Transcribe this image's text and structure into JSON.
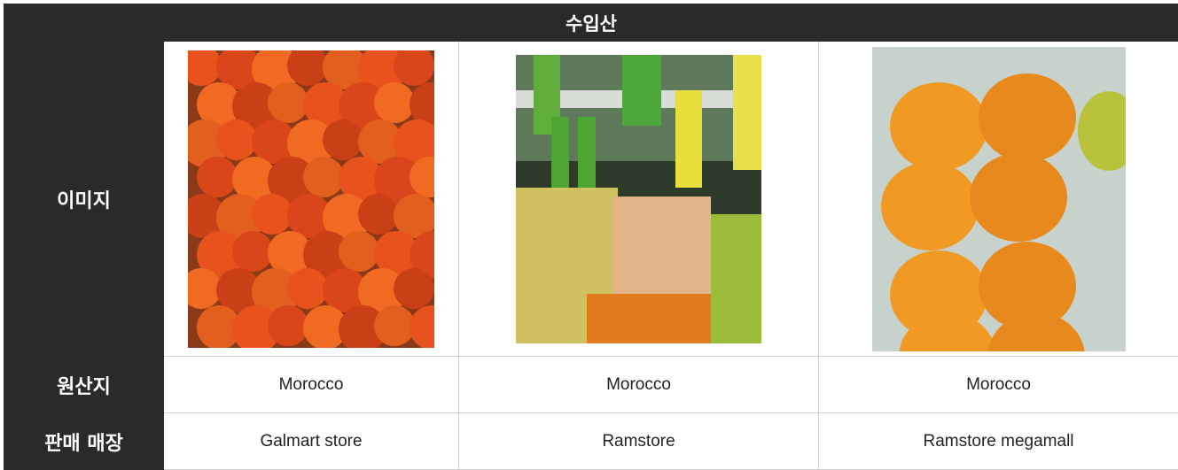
{
  "header": {
    "title": "수입산"
  },
  "rows": {
    "image_label": "이미지",
    "origin_label": "원산지",
    "store_label": "판매 매장"
  },
  "products": [
    {
      "image": "tomato-photo",
      "origin": "Morocco",
      "store": "Galmart store"
    },
    {
      "image": "market-fruit-display-photo",
      "origin": "Morocco",
      "store": "Ramstore"
    },
    {
      "image": "tangerines-in-plastic-tray-photo",
      "origin": "Morocco",
      "store": "Ramstore megamall"
    }
  ]
}
